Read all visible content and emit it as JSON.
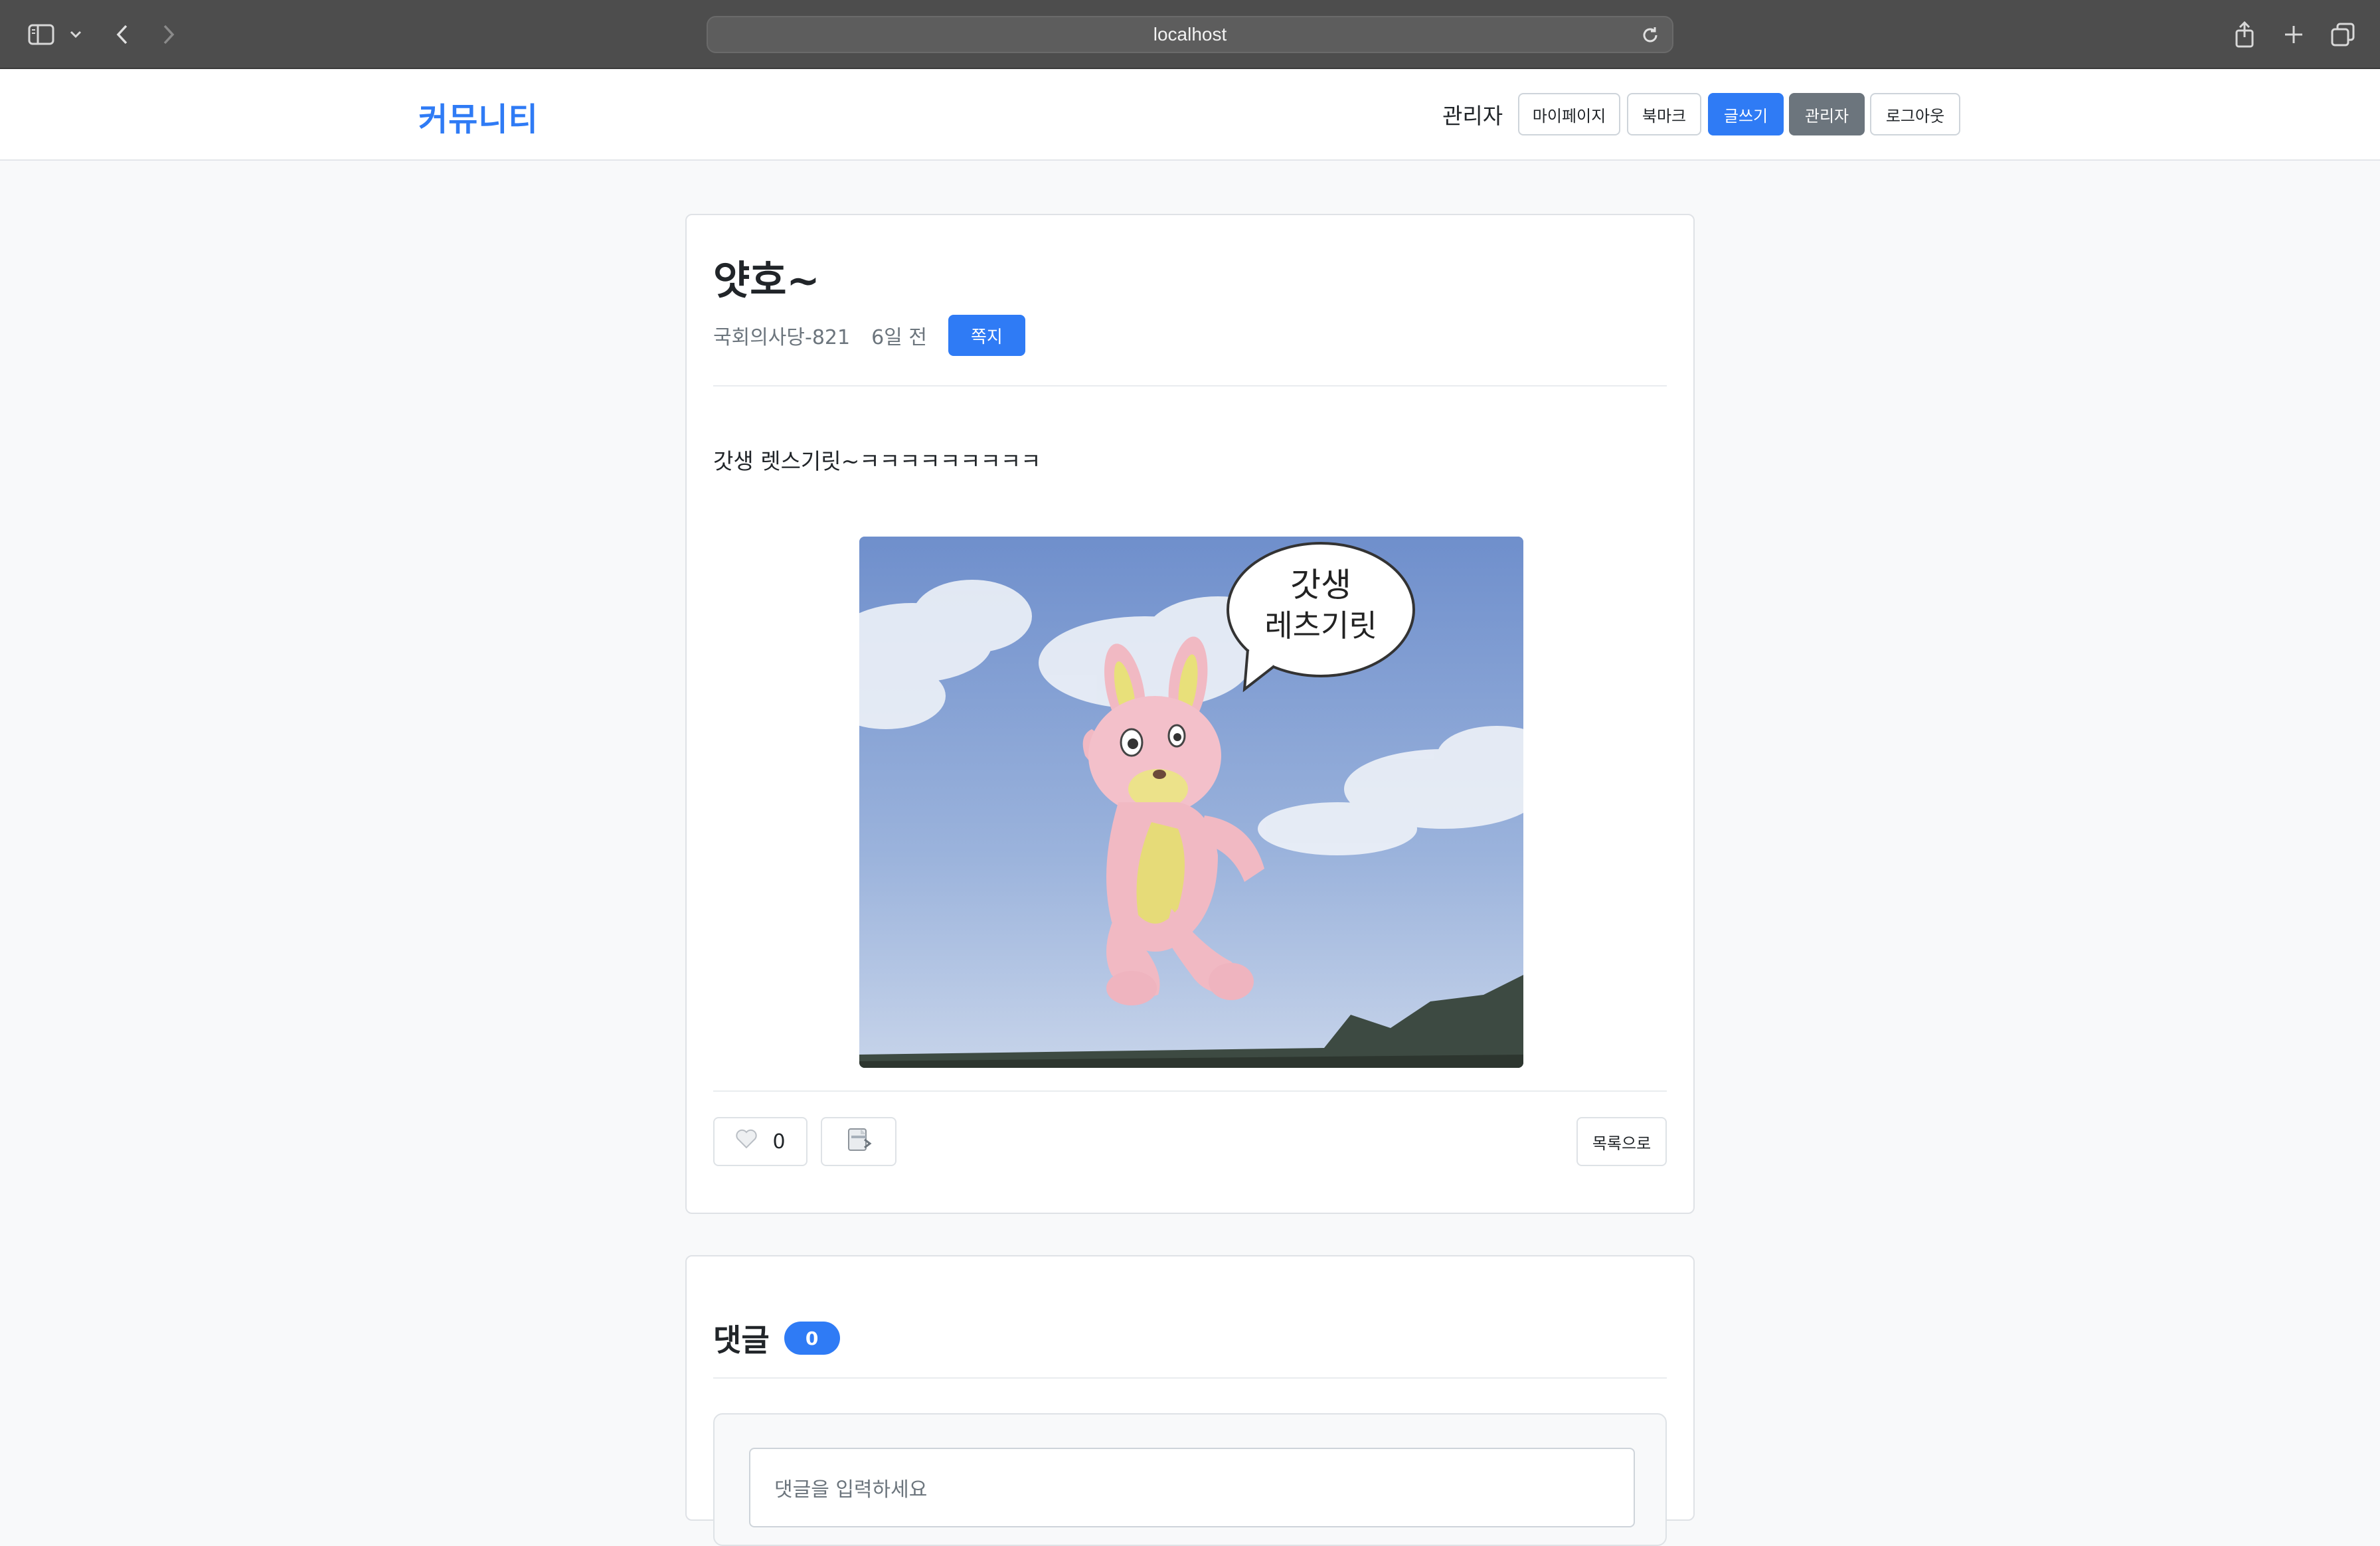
{
  "browser": {
    "url": "localhost"
  },
  "header": {
    "logo": "커뮤니티",
    "user": "관리자",
    "buttons": {
      "mypage": "마이페이지",
      "bookmark": "북마크",
      "write": "글쓰기",
      "admin": "관리자",
      "logout": "로그아웃"
    }
  },
  "post": {
    "title": "얏호~",
    "author": "국회의사당-821",
    "date": "6일 전",
    "message_button": "쪽지",
    "body": "갓생 렛스기릿~ㅋㅋㅋㅋㅋㅋㅋㅋㅋ",
    "image_caption": "갓생\n레츠기릿",
    "like_count": "0",
    "list_button": "목록으로"
  },
  "comments": {
    "title": "댓글",
    "count": "0",
    "placeholder": "댓글을 입력하세요"
  },
  "colors": {
    "primary": "#2f7bf5",
    "secondary": "#6c757d",
    "background": "#f8f9fa",
    "chrome": "#4d4d4d"
  },
  "icons": {
    "sidebar": "sidebar-icon",
    "back": "chevron-left-icon",
    "forward": "chevron-right-icon",
    "reload": "reload-icon",
    "share": "share-icon",
    "new_tab": "plus-icon",
    "tabs": "tabs-icon",
    "like": "heart-icon",
    "share_post": "share-document-icon"
  }
}
